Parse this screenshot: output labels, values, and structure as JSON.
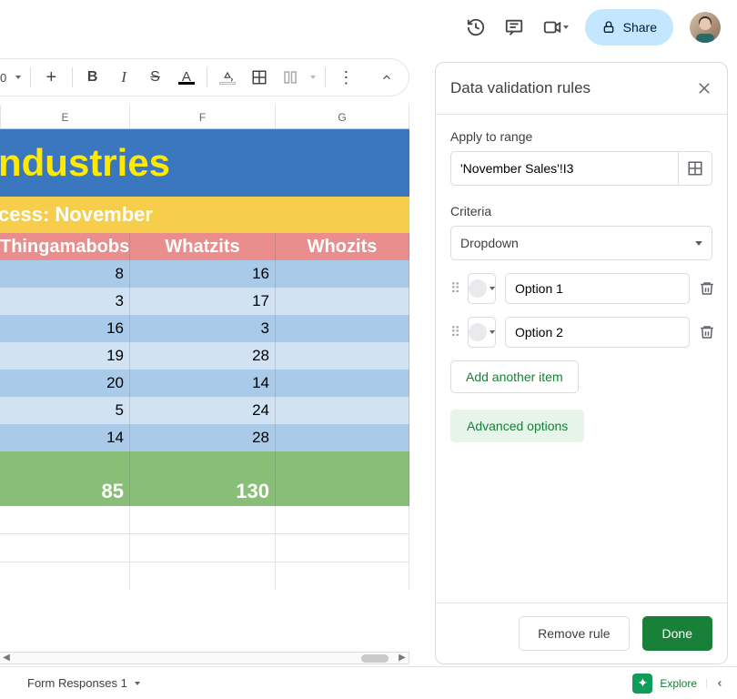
{
  "topbar": {
    "share_label": "Share"
  },
  "panel": {
    "title": "Data validation rules",
    "apply_label": "Apply to range",
    "range_value": "'November Sales'!I3",
    "criteria_label": "Criteria",
    "criteria_value": "Dropdown",
    "options": [
      "Option 1",
      "Option 2"
    ],
    "add_item": "Add another item",
    "advanced": "Advanced options",
    "remove": "Remove rule",
    "done": "Done"
  },
  "columns": {
    "e": "E",
    "f": "F",
    "g": "G"
  },
  "sheet": {
    "title_fragment": "ndustries",
    "subtitle_fragment": "cess: November",
    "h1": "Thingamabobs",
    "h2": "Whatzits",
    "h3": "Whozits",
    "rows": [
      {
        "a": "8",
        "b": "16"
      },
      {
        "a": "3",
        "b": "17"
      },
      {
        "a": "16",
        "b": "3"
      },
      {
        "a": "19",
        "b": "28"
      },
      {
        "a": "20",
        "b": "14"
      },
      {
        "a": "5",
        "b": "24"
      },
      {
        "a": "14",
        "b": "28"
      }
    ],
    "total_a": "85",
    "total_b": "130"
  },
  "bottom": {
    "tab": "Form Responses 1",
    "explore": "Explore"
  },
  "zoom_hint": "0"
}
